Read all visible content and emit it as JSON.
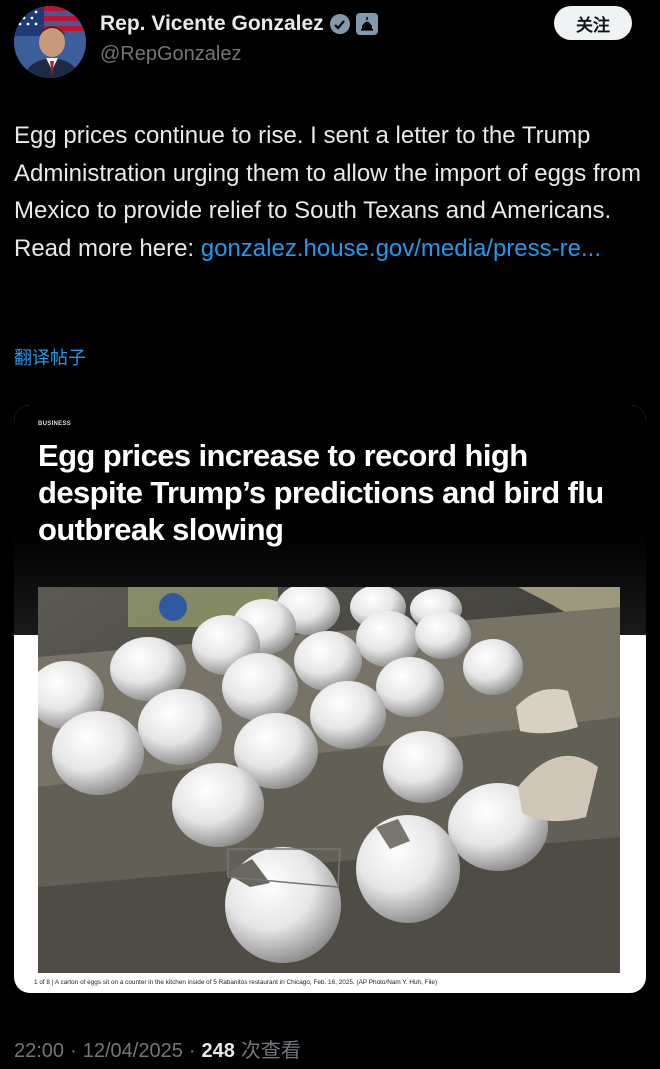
{
  "author": {
    "name": "Rep. Vicente Gonzalez",
    "handle": "@RepGonzalez",
    "verified_icon": "verified-check-icon",
    "gov_badge_icon": "capitol-building-icon"
  },
  "follow_label": "关注",
  "tweet": {
    "text": "Egg prices continue to rise. I sent a letter to the Trump Administration urging them to allow the import of eggs from Mexico to provide relief to South Texans and Americans. Read more here: ",
    "link": "gonzalez.house.gov/media/press-re..."
  },
  "translate_label": "翻译帖子",
  "media": {
    "kicker": "BUSINESS",
    "headline": "Egg prices increase to record high despite Trump’s predictions and bird flu outbreak slowing",
    "caption": "1 of 8 | A carton of eggs sit on a counter in the kitchen inside of 5 Rabanitos restaurant in Chicago, Feb. 16, 2025. (AP Photo/Nam Y. Huh, File)"
  },
  "meta": {
    "time": "22:00",
    "separator": "·",
    "date": "12/04/2025",
    "views": "248",
    "views_label": "次查看"
  },
  "colors": {
    "background": "#000000",
    "link": "#1d9bf0",
    "secondary_text": "#71767b",
    "badge_gray": "#829aab"
  }
}
